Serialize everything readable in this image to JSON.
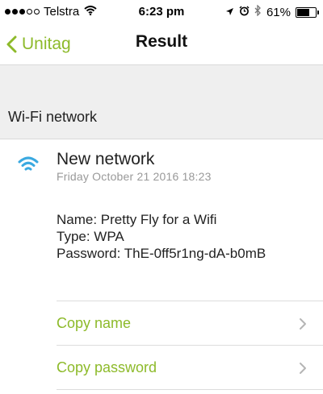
{
  "status_bar": {
    "carrier": "Telstra",
    "signal_bars_filled": 3,
    "signal_bars_total": 5,
    "time": "6:23 pm",
    "battery_text": "61%",
    "battery_level": 0.61
  },
  "nav": {
    "back_label": "Unitag",
    "title": "Result"
  },
  "section": {
    "header": "Wi-Fi network"
  },
  "network": {
    "title": "New network",
    "date": "Friday October 21 2016 18:23",
    "name_line": "Name: Pretty Fly for a Wifi",
    "type_line": "Type: WPA",
    "password_line": "Password: ThE-0ff5r1ng-dA-b0mB"
  },
  "actions": {
    "copy_name": "Copy name",
    "copy_password": "Copy password"
  },
  "colors": {
    "accent": "#8dba2a",
    "wifi_icon": "#3aa9e0",
    "section_bg": "#efefef"
  }
}
